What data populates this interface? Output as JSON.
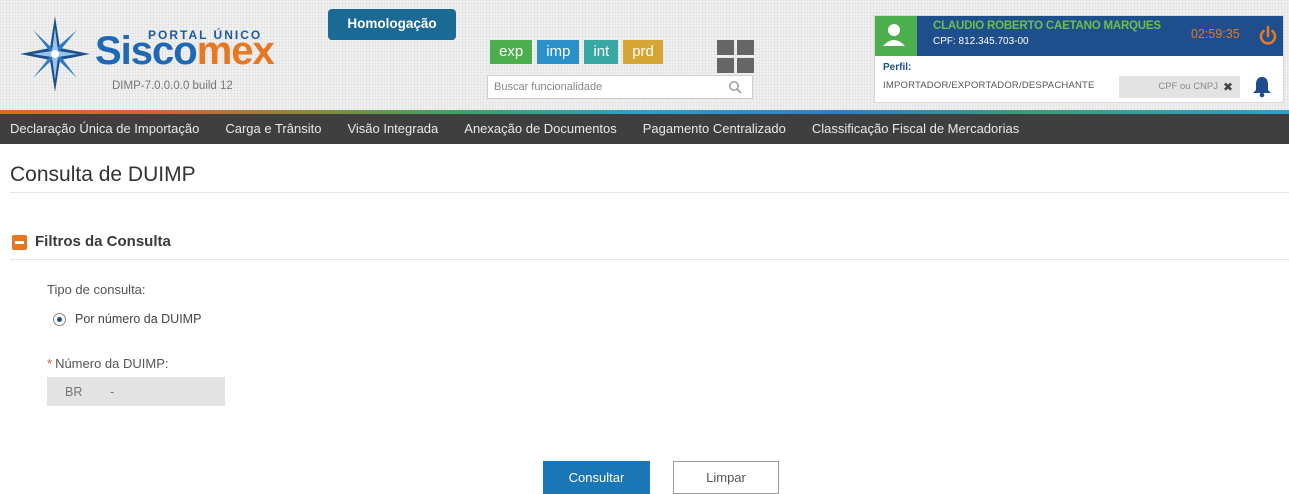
{
  "header": {
    "portal_label": "PORTAL ÚNICO",
    "brand_part1": "Sisco",
    "brand_part2": "mex",
    "version": "DIMP-7.0.0.0.0   build 12",
    "environment_badge": "Homologação",
    "env_tabs": [
      {
        "label": "exp",
        "color": "#4cae4c"
      },
      {
        "label": "imp",
        "color": "#2b8fc8"
      },
      {
        "label": "int",
        "color": "#37a8a2"
      },
      {
        "label": "prd",
        "color": "#d5a634"
      }
    ],
    "search_placeholder": "Buscar funcionalidade",
    "grid_icon": "apps-grid-icon"
  },
  "user": {
    "name": "CLAUDIO ROBERTO CAETANO MARQUES",
    "cpf": "CPF: 812.345.703-00",
    "session_timer": "02:59:35",
    "perfil_label": "Perfil:",
    "perfil_value": "IMPORTADOR/EXPORTADOR/DESPACHANTE",
    "cpf_cnpj_placeholder": "CPF ou CNPJ",
    "clear_symbol": "✖"
  },
  "nav": {
    "items": [
      "Declaração Única de Importação",
      "Carga e Trânsito",
      "Visão Integrada",
      "Anexação de Documentos",
      "Pagamento Centralizado",
      "Classificação Fiscal de Mercadorias"
    ]
  },
  "page": {
    "title": "Consulta de DUIMP",
    "filters_title": "Filtros da Consulta",
    "tipo_label": "Tipo de consulta:",
    "radio_option": "Por número da DUIMP",
    "required_mark": "*",
    "numero_label": "Número da DUIMP:",
    "numero_placeholder": "BR        -",
    "consultar_button": "Consultar",
    "limpar_button": "Limpar"
  },
  "colors": {
    "brand_blue": "#1f68b3",
    "brand_orange": "#e87722",
    "nav_bg": "#3f3f3f",
    "user_panel_bg": "#1f4e8c",
    "primary_button": "#1a76b4"
  }
}
